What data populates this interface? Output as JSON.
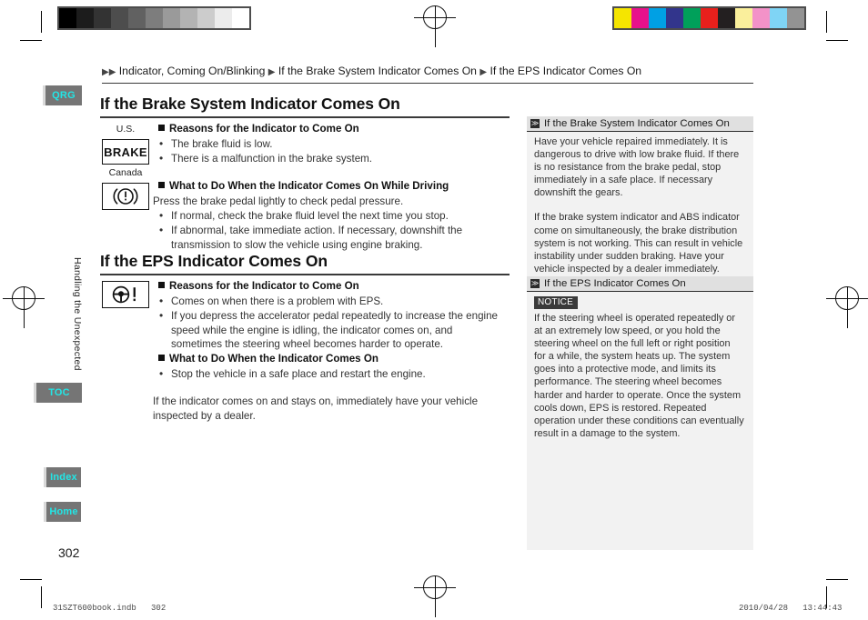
{
  "document": {
    "page_number": "302",
    "side_tab_label": "Handling the Unexpected",
    "footer_left": "31SZT600book.indb   302",
    "footer_right": "2010/04/28   13:44:43"
  },
  "nav": {
    "qrg": "QRG",
    "toc": "TOC",
    "index": "Index",
    "home": "Home"
  },
  "breadcrumb": {
    "arrow": "▶",
    "item1": "Indicator, Coming On/Blinking",
    "item2": "If the Brake System Indicator Comes On",
    "item3": "If the EPS Indicator Comes On"
  },
  "sections": {
    "brake": {
      "title": "If the Brake System Indicator Comes On",
      "icons": {
        "us_caption": "U.S.",
        "us_label": "BRAKE",
        "canada_caption": "Canada",
        "canada_icon": "brake-warning-icon"
      },
      "reasons_heading": "Reasons for the Indicator to Come On",
      "reasons": [
        "The brake fluid is low.",
        "There is a malfunction in the brake system."
      ],
      "what_to_do_heading": "What to Do When the Indicator Comes On While Driving",
      "what_to_do_intro": "Press the brake pedal lightly to check pedal pressure.",
      "what_to_do": [
        "If normal, check the brake fluid level the next time you stop.",
        "If abnormal, take immediate action. If necessary, downshift the transmission to slow the vehicle using engine braking."
      ]
    },
    "eps": {
      "title": "If the EPS Indicator Comes On",
      "icon": "steering-wheel-warning-icon",
      "reasons_heading": "Reasons for the Indicator to Come On",
      "reasons": [
        "Comes on when there is a problem with EPS.",
        "If you depress the accelerator pedal repeatedly to increase the engine speed while the engine is idling, the indicator comes on, and sometimes the steering wheel becomes harder to operate."
      ],
      "what_to_do_heading": "What to Do When the Indicator Comes On",
      "what_to_do": [
        "Stop the vehicle in a safe place and restart the engine."
      ],
      "closing": "If the indicator comes on and stays on, immediately have your vehicle inspected by a dealer."
    }
  },
  "panel": {
    "brake": {
      "glyph": "≫",
      "heading": "If the Brake System Indicator Comes On",
      "para1": "Have your vehicle repaired immediately.\nIt is dangerous to drive with low brake fluid. If there is no resistance from the brake pedal, stop immediately in a safe place. If necessary downshift the gears.",
      "para2": "If the brake system indicator and ABS indicator come on simultaneously, the brake distribution system is not working. This can result in vehicle instability under sudden braking. Have your vehicle inspected by a dealer immediately."
    },
    "eps": {
      "glyph": "≫",
      "heading": "If the EPS Indicator Comes On",
      "notice_label": "NOTICE",
      "para1": "If the steering wheel is operated repeatedly or at an extremely low speed, or you hold the steering wheel on the full left or right position for a while, the system heats up. The system goes into a protective mode, and limits its performance. The steering wheel becomes harder and harder to operate. Once the system cools down, EPS is restored. Repeated operation under these conditions can eventually result in a damage to the system."
    }
  },
  "calibration": {
    "gray_bar": [
      "#000000",
      "#1c1c1c",
      "#333333",
      "#4d4d4d",
      "#616161",
      "#7d7d7d",
      "#9a9a9a",
      "#b3b3b3",
      "#cccccc",
      "#ececec",
      "#ffffff"
    ],
    "color_bar": [
      "#f5e500",
      "#e8118b",
      "#00a0e4",
      "#32358c",
      "#00a05a",
      "#e8201c",
      "#231f20",
      "#faef9c",
      "#f392c8",
      "#7fd4f5",
      "#939393"
    ]
  },
  "colors": {
    "nav_button_bg": "#757575",
    "nav_button_text": "#22e6e6",
    "panel_bg": "#f2f2f2",
    "panel_head_bg": "#e0e0e0",
    "notice_bg": "#3a3a3a"
  }
}
